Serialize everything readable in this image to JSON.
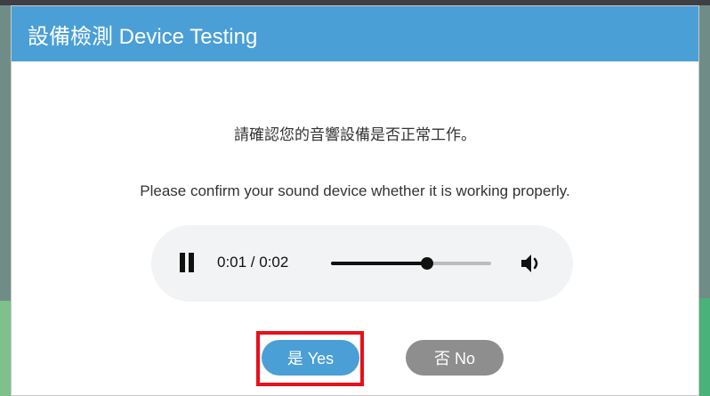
{
  "dialog": {
    "title": "設備檢測 Device Testing",
    "prompt_zh": "請確認您的音響設備是否正常工作。",
    "prompt_en": "Please confirm your sound device whether it is working properly."
  },
  "audio": {
    "state": "playing",
    "time": "0:01 / 0:02",
    "progress": 0.6,
    "controls": {
      "play_pause_icon": "pause-icon",
      "volume_icon": "volume-icon"
    }
  },
  "buttons": {
    "yes_label": "是 Yes",
    "no_label": "否 No"
  },
  "colors": {
    "header": "#4a9fd6",
    "yes_button": "#4a9fd6",
    "no_button": "#8e8e8e",
    "highlight": "#e8101a"
  }
}
